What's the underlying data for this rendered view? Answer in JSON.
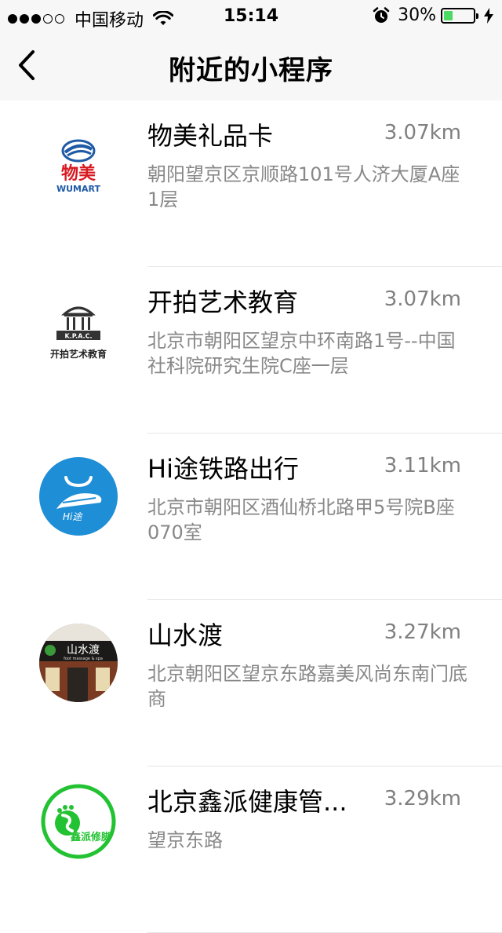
{
  "status_bar": {
    "carrier": "中国移动",
    "time": "15:14",
    "battery_percent": "30%",
    "battery_level": 0.3,
    "signal_filled": 3,
    "signal_total": 5
  },
  "nav": {
    "title": "附近的小程序",
    "back_icon": "chevron-left-icon"
  },
  "items": [
    {
      "name": "物美礼品卡",
      "distance": "3.07km",
      "address": "朝阳望京区京顺路101号人济大厦A座1层",
      "logo_text": "物美",
      "logo_subtext": "WUMART"
    },
    {
      "name": "开拍艺术教育",
      "distance": "3.07km",
      "address": "北京市朝阳区望京中环南路1号--中国社科院研究生院C座一层",
      "logo_text": "开拍艺术教育",
      "logo_subtext": "K.P.A.C."
    },
    {
      "name": "Hi途铁路出行",
      "distance": "3.11km",
      "address": "北京市朝阳区酒仙桥北路甲5号院B座070室",
      "logo_text": "Hi途"
    },
    {
      "name": "山水渡",
      "distance": "3.27km",
      "address": "北京朝阳区望京东路嘉美风尚东南门底商",
      "logo_text": "山水渡",
      "logo_subtext": "foot massage & spa"
    },
    {
      "name": "北京鑫派健康管...",
      "distance": "3.29km",
      "address": "望京东路",
      "logo_text": "鑫派修脚"
    }
  ],
  "colors": {
    "bar_bg": "#f7f7f7",
    "secondary_text": "#888888",
    "battery_green": "#4cd964",
    "hitu_blue": "#1e8fd6",
    "xinpai_green": "#22c232",
    "wumart_red": "#d71920",
    "wumart_blue": "#1f5aa6"
  }
}
